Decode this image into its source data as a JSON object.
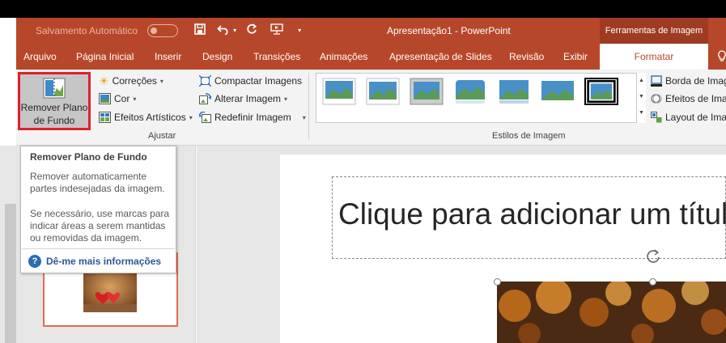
{
  "quick_access": {
    "autosave_label": "Salvamento Automático",
    "autosave_state": "off",
    "icons": [
      "save-icon",
      "undo-icon",
      "redo-icon",
      "start-from-beginning-icon",
      "customize-icon"
    ]
  },
  "window": {
    "title": "Apresentação1  -  PowerPoint",
    "context_tab_group": "Ferramentas de Imagem"
  },
  "tabs": [
    {
      "label": "Arquivo"
    },
    {
      "label": "Página Inicial"
    },
    {
      "label": "Inserir"
    },
    {
      "label": "Design"
    },
    {
      "label": "Transições"
    },
    {
      "label": "Animações"
    },
    {
      "label": "Apresentação de Slides"
    },
    {
      "label": "Revisão"
    },
    {
      "label": "Exibir"
    },
    {
      "label": "Formatar",
      "active": true
    }
  ],
  "ribbon": {
    "ajustar": {
      "group_label": "Ajustar",
      "remove_bg_label_line1": "Remover Plano",
      "remove_bg_label_line2": "de Fundo",
      "corrections": "Correções",
      "color": "Cor",
      "artistic_effects": "Efeitos Artísticos",
      "compress": "Compactar Imagens",
      "change": "Alterar Imagem",
      "reset": "Redefinir Imagem"
    },
    "estilos": {
      "group_label": "Estilos de Imagem",
      "styles_count": 7,
      "selected_style_index": 6,
      "border": "Borda de Imagem",
      "effects": "Efeitos de Imagem",
      "layout": "Layout de Imagem"
    }
  },
  "tooltip": {
    "title": "Remover Plano de Fundo",
    "description": "Remover automaticamente partes indesejadas da imagem.",
    "description2": "Se necessário, use marcas para indicar áreas a serem mantidas ou removidas da imagem.",
    "more_info": "Dê-me mais informações"
  },
  "slide": {
    "title_placeholder": "Clique para adicionar um título"
  },
  "colors": {
    "accent": "#b7472a",
    "context_tab": "#9e3b22",
    "highlight": "#e0202a",
    "link": "#2b579a",
    "thumbnail_border": "#e06c50"
  }
}
